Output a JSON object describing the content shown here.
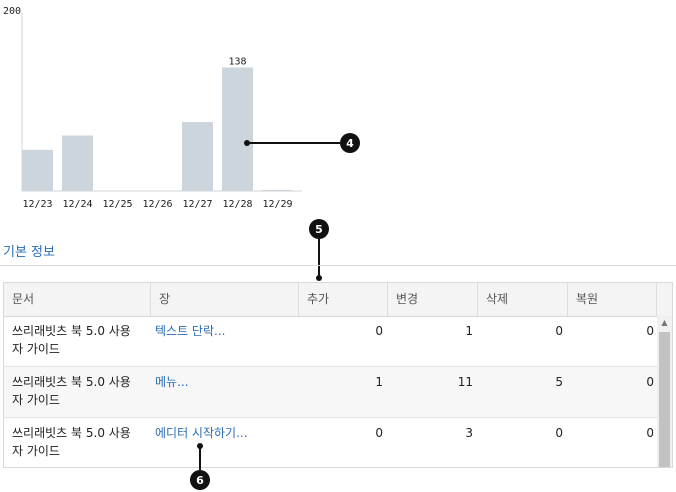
{
  "chart_data": {
    "type": "bar",
    "categories": [
      "12/23",
      "12/24",
      "12/25",
      "12/26",
      "12/27",
      "12/28",
      "12/29"
    ],
    "values": [
      46,
      62,
      0,
      0,
      77,
      138,
      1
    ],
    "ylim": [
      0,
      200
    ],
    "y_max_label": "200",
    "data_labels": {
      "5": "138"
    },
    "bar_color": "#cdd5dc",
    "grid": false
  },
  "callouts": {
    "c4": "4",
    "c5": "5",
    "c6": "6"
  },
  "section": {
    "title": "기본 정보"
  },
  "table": {
    "headers": [
      "문서",
      "장",
      "추가",
      "변경",
      "삭제",
      "복원"
    ],
    "rows": [
      {
        "doc_line1": "쓰리래빗츠 북 5.0 사용",
        "doc_line2": "자 가이드",
        "chapter": "텍스트 단락...",
        "added": "0",
        "changed": "1",
        "deleted": "0",
        "restored": "0"
      },
      {
        "doc_line1": "쓰리래빗츠 북 5.0 사용",
        "doc_line2": "자 가이드",
        "chapter": "메뉴...",
        "added": "1",
        "changed": "11",
        "deleted": "5",
        "restored": "0"
      },
      {
        "doc_line1": "쓰리래빗츠 북 5.0 사용",
        "doc_line2": "자 가이드",
        "chapter": "에디터 시작하기...",
        "added": "0",
        "changed": "3",
        "deleted": "0",
        "restored": "0"
      }
    ]
  },
  "icons": {
    "scroll_up": "triangle-up-icon"
  }
}
